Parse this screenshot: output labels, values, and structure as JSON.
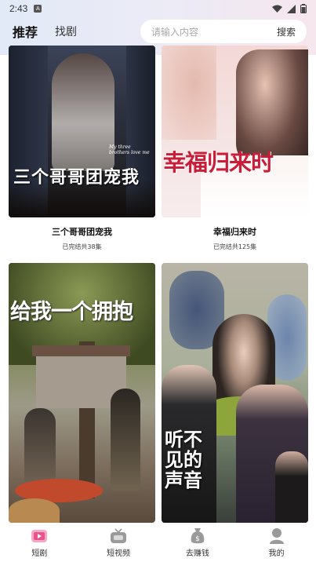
{
  "status_bar": {
    "time": "2:43",
    "sim_label": "A"
  },
  "header": {
    "tabs": [
      {
        "label": "推荐",
        "active": true
      },
      {
        "label": "找剧",
        "active": false
      }
    ],
    "search": {
      "placeholder": "请输入内容",
      "button": "搜索"
    }
  },
  "dramas": [
    {
      "title": "三个哥哥团宠我",
      "status": "已完结共38集",
      "poster_text": "三个哥哥团宠我",
      "poster_small": "My three brothers love me"
    },
    {
      "title": "幸福归来时",
      "status": "已完结共125集",
      "poster_text": "幸福归来时",
      "poster_small": ""
    },
    {
      "title": "",
      "status": "",
      "poster_text": "给我一个拥抱",
      "poster_small": ""
    },
    {
      "title": "",
      "status": "",
      "poster_text": "听不见的声音",
      "poster_small": ""
    }
  ],
  "bottom_nav": [
    {
      "label": "短剧",
      "icon": "short-drama-icon",
      "active": true
    },
    {
      "label": "短视频",
      "icon": "tv-icon",
      "active": false
    },
    {
      "label": "去赚钱",
      "icon": "money-bag-icon",
      "active": false
    },
    {
      "label": "我的",
      "icon": "profile-icon",
      "active": false
    }
  ],
  "colors": {
    "accent": "#e8548a"
  }
}
